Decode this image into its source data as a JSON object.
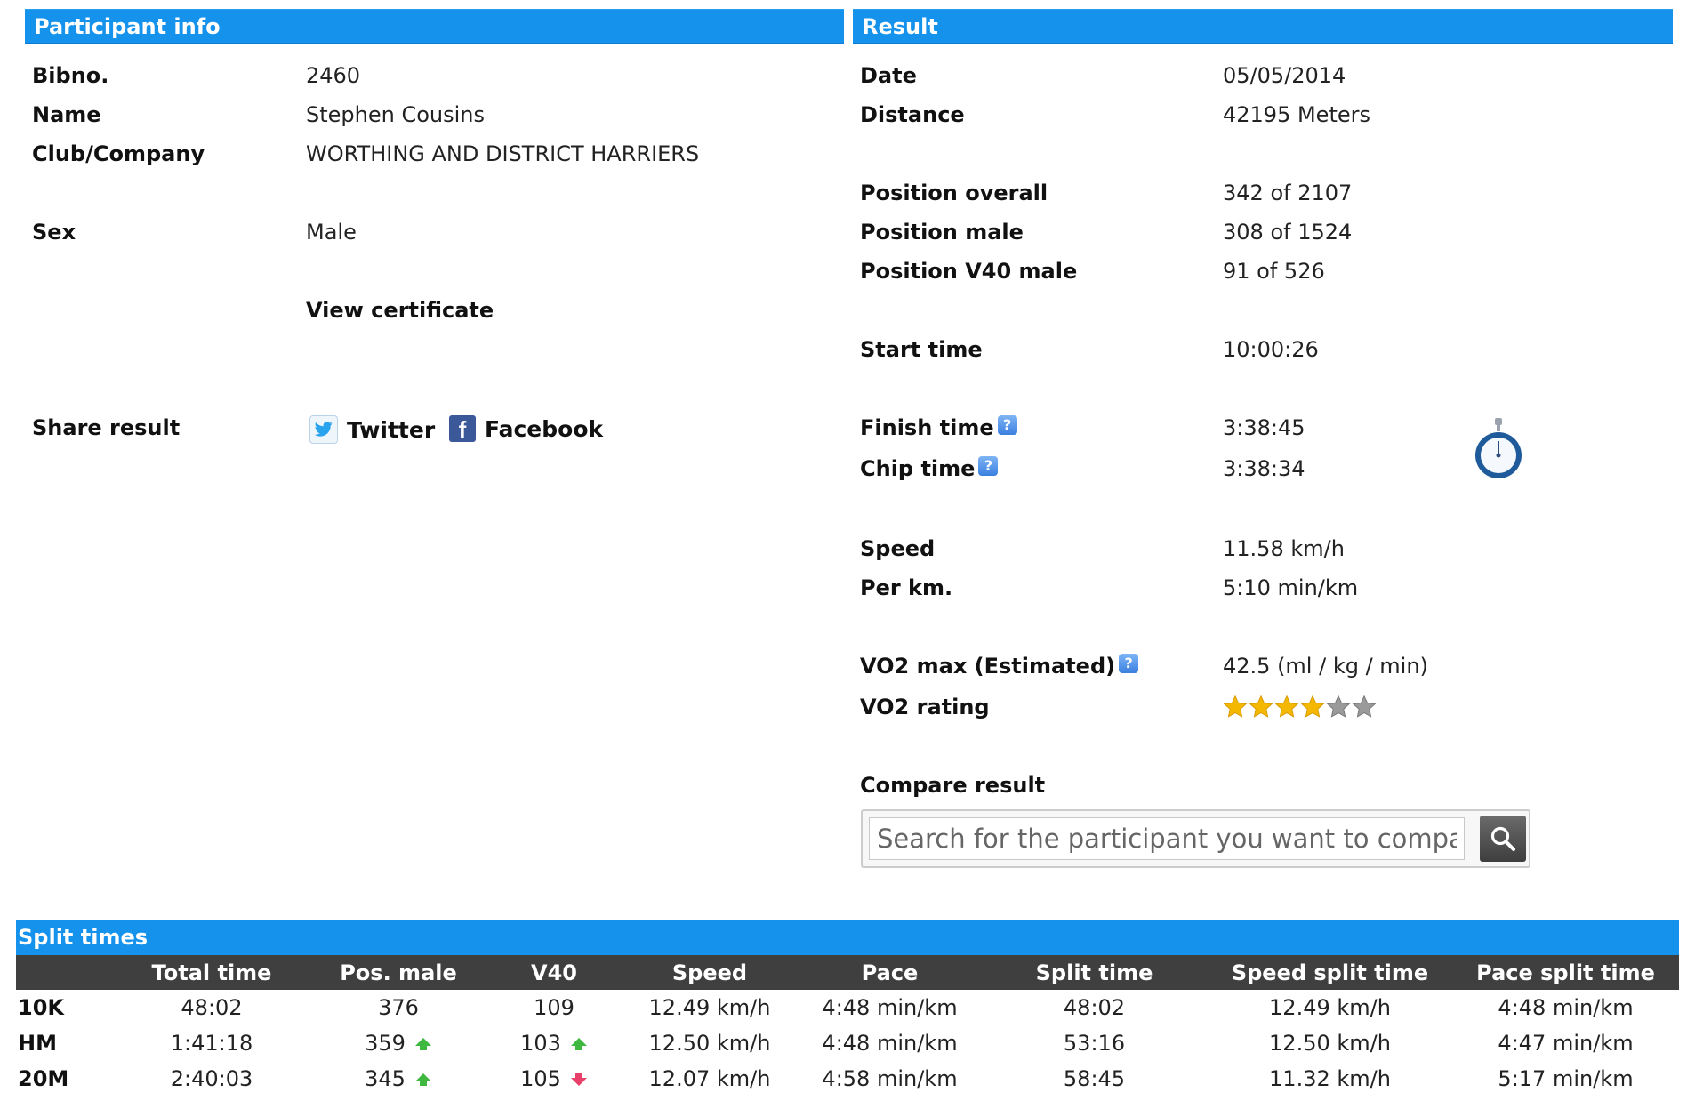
{
  "participant": {
    "header": "Participant info",
    "bibno_label": "Bibno.",
    "bibno": "2460",
    "name_label": "Name",
    "name": "Stephen Cousins",
    "club_label": "Club/Company",
    "club": "WORTHING AND DISTRICT HARRIERS",
    "sex_label": "Sex",
    "sex": "Male",
    "certificate_link": "View certificate",
    "share_label": "Share result",
    "twitter": "Twitter",
    "facebook": "Facebook"
  },
  "result": {
    "header": "Result",
    "date_label": "Date",
    "date": "05/05/2014",
    "distance_label": "Distance",
    "distance": "42195 Meters",
    "pos_overall_label": "Position overall",
    "pos_overall": "342 of 2107",
    "pos_male_label": "Position male",
    "pos_male": "308 of 1524",
    "pos_v40_label": "Position V40 male",
    "pos_v40": "91 of 526",
    "start_label": "Start time",
    "start": "10:00:26",
    "finish_label": "Finish time",
    "finish": "3:38:45",
    "chip_label": "Chip time",
    "chip": "3:38:34",
    "speed_label": "Speed",
    "speed": "11.58 km/h",
    "perkm_label": "Per km.",
    "perkm": "5:10 min/km",
    "vo2_label": "VO2 max (Estimated)",
    "vo2": "42.5 (ml / kg / min)",
    "vo2_rating_label": "VO2 rating",
    "vo2_rating": {
      "filled": 4,
      "total": 6
    },
    "compare_label": "Compare result",
    "compare_placeholder": "Search for the participant you want to compare t"
  },
  "splits": {
    "header": "Split times",
    "columns": [
      "",
      "Total time",
      "Pos. male",
      "V40",
      "Speed",
      "Pace",
      "Split time",
      "Speed split time",
      "Pace split time"
    ],
    "rows": [
      {
        "label": "10K",
        "total": "48:02",
        "pos_male": "376",
        "pos_male_trend": "none",
        "v40": "109",
        "v40_trend": "none",
        "speed": "12.49 km/h",
        "pace": "4:48 min/km",
        "split": "48:02",
        "speed_split": "12.49 km/h",
        "pace_split": "4:48 min/km"
      },
      {
        "label": "HM",
        "total": "1:41:18",
        "pos_male": "359",
        "pos_male_trend": "up",
        "v40": "103",
        "v40_trend": "up",
        "speed": "12.50 km/h",
        "pace": "4:48 min/km",
        "split": "53:16",
        "speed_split": "12.50 km/h",
        "pace_split": "4:47 min/km"
      },
      {
        "label": "20M",
        "total": "2:40:03",
        "pos_male": "345",
        "pos_male_trend": "up",
        "v40": "105",
        "v40_trend": "down",
        "speed": "12.07 km/h",
        "pace": "4:58 min/km",
        "split": "58:45",
        "speed_split": "11.32 km/h",
        "pace_split": "5:17 min/km"
      }
    ]
  },
  "colors": {
    "header_blue": "#1492ec",
    "table_head": "#3f3f3f",
    "star": "#f5b800",
    "trend_up": "#3fb83f",
    "trend_down": "#e8406a"
  }
}
